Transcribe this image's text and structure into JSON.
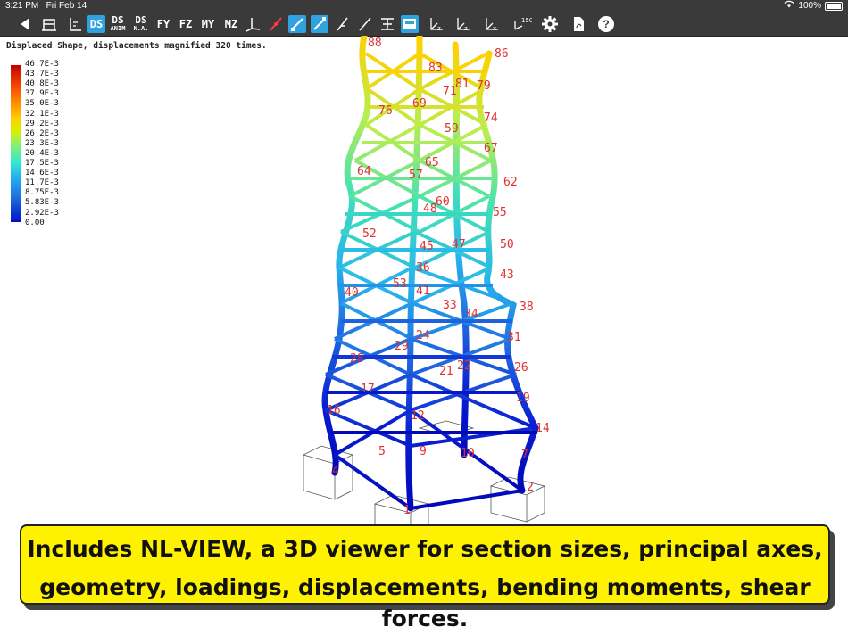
{
  "status": {
    "time": "3:21 PM",
    "date": "Fri Feb 14",
    "battery": "100%"
  },
  "toolbar": {
    "back_icon": "back-triangle-icon",
    "buttons": [
      {
        "name": "frame-icon",
        "label": ""
      },
      {
        "name": "axes-icon",
        "label": ""
      },
      {
        "name": "ds",
        "label": "DS"
      },
      {
        "name": "ds-anim",
        "label": "DS",
        "sub": "ANIM"
      },
      {
        "name": "ds-na",
        "label": "DS",
        "sub": "N.A."
      },
      {
        "name": "fy",
        "label": "FY"
      },
      {
        "name": "fz",
        "label": "FZ"
      },
      {
        "name": "my",
        "label": "MY"
      },
      {
        "name": "mz",
        "label": "MZ"
      }
    ],
    "icon_set": [
      "axis-triad-icon",
      "red-line-icon",
      "member-icon",
      "member-active-icon",
      "slope-icon",
      "line-icon",
      "section-icon",
      "display-active-icon",
      "local-yz-icon",
      "local-xz-icon",
      "local-x-icon",
      "rotate-150-icon",
      "gear-icon",
      "pdf-icon",
      "help-icon"
    ],
    "rotate_label": "150",
    "help_label": "?"
  },
  "viewer": {
    "caption": "Displaced Shape, displacements magnified 320 times.",
    "legend": [
      "46.7E-3",
      "43.7E-3",
      "40.8E-3",
      "37.9E-3",
      "35.0E-3",
      "32.1E-3",
      "29.2E-3",
      "26.2E-3",
      "23.3E-3",
      "20.4E-3",
      "17.5E-3",
      "14.6E-3",
      "11.7E-3",
      "8.75E-3",
      "5.83E-3",
      "2.92E-3",
      "0.00"
    ],
    "node_labels": [
      "86",
      "79",
      "74",
      "67",
      "62",
      "55",
      "50",
      "43",
      "38",
      "31",
      "26",
      "19",
      "14",
      "7",
      "2",
      "88",
      "76",
      "64",
      "52",
      "40",
      "28",
      "16",
      "4",
      "1",
      "69",
      "57",
      "45",
      "33",
      "21",
      "9",
      "71",
      "59",
      "48",
      "36",
      "24",
      "12",
      "81",
      "65",
      "53",
      "41",
      "29",
      "17",
      "5",
      "83",
      "60",
      "47",
      "34",
      "22",
      "10"
    ]
  },
  "banner": {
    "line1": "Includes NL-VIEW, a 3D viewer for section sizes, principal axes,",
    "line2": "geometry, loadings, displacements, bending moments, shear forces."
  }
}
